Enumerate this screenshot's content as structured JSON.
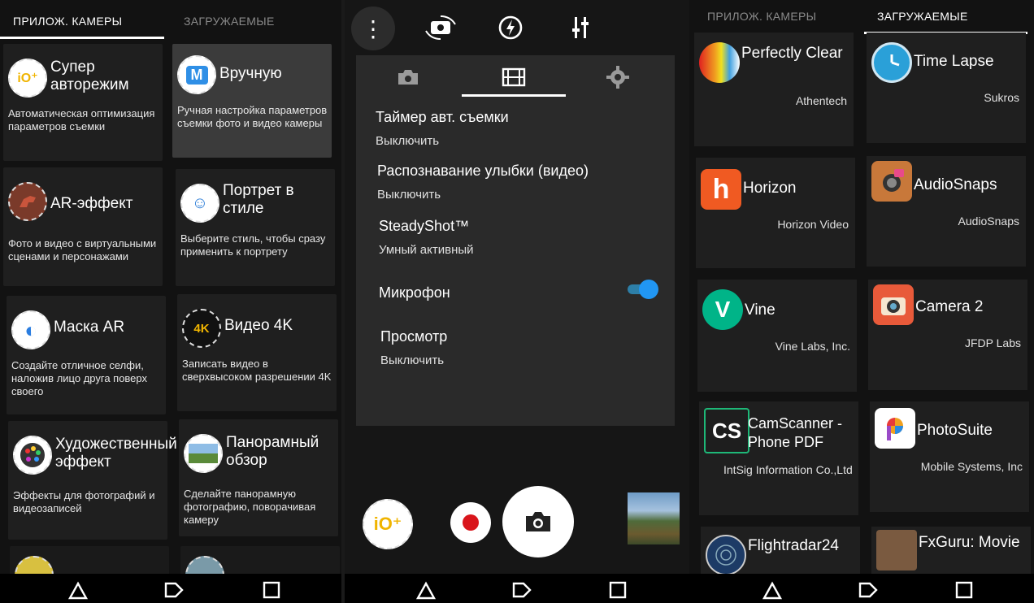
{
  "left": {
    "tabs": [
      "ПРИЛОЖ. КАМЕРЫ",
      "ЗАГРУЖАЕМЫЕ"
    ],
    "cards": [
      {
        "title": "Супер авторежим",
        "desc": "Автоматическая оптимизация параметров съемки",
        "icon": "ia-plus-icon",
        "icon_text": "iO⁺"
      },
      {
        "title": "Вручную",
        "desc": "Ручная настройка параметров съемки фото и видео камеры",
        "icon": "manual-m-icon",
        "icon_text": "M"
      },
      {
        "title": "AR-эффект",
        "desc": "Фото и видео с виртуальными сценами и персонажами",
        "icon": "dinosaur-icon",
        "icon_text": ""
      },
      {
        "title": "Портрет в стиле",
        "desc": "Выберите стиль, чтобы сразу применить к портрету",
        "icon": "face-icon",
        "icon_text": "☺"
      },
      {
        "title": "Маска AR",
        "desc": "Создайте отличное селфи, наложив лицо друга поверх своего",
        "icon": "mask-icon",
        "icon_text": "◐"
      },
      {
        "title": "Видео 4K",
        "desc": "Записать видео в сверхвысоком разрешении 4K",
        "icon": "video-4k-icon",
        "icon_text": "4K"
      },
      {
        "title": "Художественный эффект",
        "desc": "Эффекты для фотографий и видеозаписей",
        "icon": "palette-icon",
        "icon_text": "●"
      },
      {
        "title": "Панорамный обзор",
        "desc": "Сделайте панорамную фотографию, поворачивая камеру",
        "icon": "panorama-icon",
        "icon_text": "▬"
      }
    ]
  },
  "middle": {
    "top_icons": [
      "more-vert-icon",
      "switch-camera-icon",
      "flash-auto-icon",
      "sliders-icon"
    ],
    "settings_tabs": [
      "camera-icon",
      "film-icon",
      "gear-icon"
    ],
    "settings": [
      {
        "label": "Таймер авт. съемки",
        "value": "Выключить"
      },
      {
        "label": "Распознавание улыбки (видео)",
        "value": "Выключить"
      },
      {
        "label": "SteadyShot™",
        "value": "Умный активный"
      },
      {
        "label": "Микрофон",
        "value": "",
        "toggle": true
      },
      {
        "label": "Просмотр",
        "value": "Выключить"
      }
    ],
    "bottom": {
      "mode_icon": "iO⁺"
    }
  },
  "right": {
    "tabs": [
      "ПРИЛОЖ. КАМЕРЫ",
      "ЗАГРУЖАЕМЫЕ"
    ],
    "apps": [
      {
        "name": "Perfectly Clear",
        "dev": "Athentech",
        "icon": "perfectly-clear-icon",
        "color": "#f0a020"
      },
      {
        "name": "Time Lapse",
        "dev": "Sukros",
        "icon": "clock-icon",
        "color": "#2aa0d8"
      },
      {
        "name": "Horizon",
        "dev": "Horizon Video",
        "icon": "horizon-h-icon",
        "color": "#f05a22",
        "glyph": "h"
      },
      {
        "name": "AudioSnaps",
        "dev": "AudioSnaps",
        "icon": "audiosnaps-icon",
        "color": "#c8783a"
      },
      {
        "name": "Vine",
        "dev": "Vine Labs, Inc.",
        "icon": "vine-icon",
        "color": "#00b488",
        "glyph": "V"
      },
      {
        "name": "Camera 2",
        "dev": "JFDP Labs",
        "icon": "camera2-icon",
        "color": "#e85a3a"
      },
      {
        "name": "CamScanner - Phone PDF",
        "dev": "IntSig Information Co.,Ltd",
        "icon": "camscanner-icon",
        "color": "#222222",
        "glyph": "CS"
      },
      {
        "name": "PhotoSuite",
        "dev": "Mobile Systems, Inc",
        "icon": "photosuite-icon",
        "color": "#ffffff"
      },
      {
        "name": "Flightradar24",
        "dev": "",
        "icon": "radar-icon",
        "color": "#1d3b66"
      },
      {
        "name": "FxGuru: Movie",
        "dev": "",
        "icon": "fxguru-icon",
        "color": "#7a5a40"
      }
    ]
  },
  "nav": [
    "back-icon",
    "home-icon",
    "recents-icon"
  ]
}
